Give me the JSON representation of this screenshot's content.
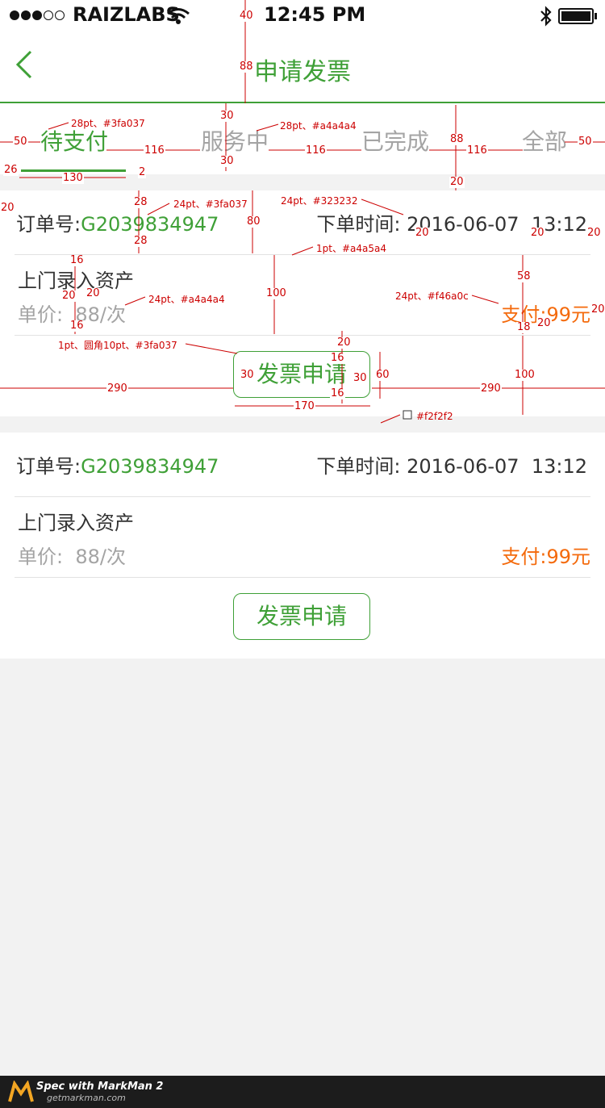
{
  "status_bar": {
    "carrier": "RAIZLABS",
    "time": "12:45 PM"
  },
  "nav": {
    "back_icon": "chevron-left-icon",
    "title": "申请发票"
  },
  "tabs": [
    {
      "label": "待支付",
      "active": true
    },
    {
      "label": "服务中",
      "active": false
    },
    {
      "label": "已完成",
      "active": false
    },
    {
      "label": "全部",
      "active": false
    }
  ],
  "orders": [
    {
      "order_label": "订单号:",
      "order_no": "G2039834947",
      "time_label": "下单时间:",
      "time_value": "2016-06-07  13:12",
      "service": "上门录入资产",
      "price_label": "单价:",
      "price_value": "88/次",
      "pay_label": "支付:",
      "pay_value": "99元",
      "button": "发票申请"
    },
    {
      "order_label": "订单号:",
      "order_no": "G2039834947",
      "time_label": "下单时间:",
      "time_value": "2016-06-07  13:12",
      "service": "上门录入资产",
      "price_label": "单价:",
      "price_value": "88/次",
      "pay_label": "支付:",
      "pay_value": "99元",
      "button": "发票申请"
    }
  ],
  "annotations": {
    "notes": [
      "28pt、#3fa037",
      "28pt、#a4a4a4",
      "24pt、#3fa037",
      "24pt、#323232",
      "1pt、#a4a5a4",
      "24pt、#a4a4a4",
      "24pt、#f46a0c",
      "1pt、圆角10pt、#3fa037",
      "#f2f2f2"
    ],
    "dims": [
      "40",
      "88",
      "30",
      "50",
      "116",
      "116",
      "30",
      "88",
      "116",
      "50",
      "26",
      "130",
      "2",
      "20",
      "20",
      "28",
      "80",
      "28",
      "20",
      "20",
      "20",
      "16",
      "20",
      "20",
      "16",
      "100",
      "58",
      "18",
      "20",
      "20",
      "20",
      "16",
      "16",
      "30",
      "30",
      "60",
      "100",
      "290",
      "170",
      "290"
    ]
  },
  "footer": {
    "brand_line": "Spec with MarkMan 2",
    "url": "getmarkman.com"
  },
  "colors": {
    "green": "#3fa037",
    "gray_text": "#a4a4a4",
    "dark_text": "#323232",
    "orange": "#f46a0c",
    "bg": "#f2f2f2"
  }
}
